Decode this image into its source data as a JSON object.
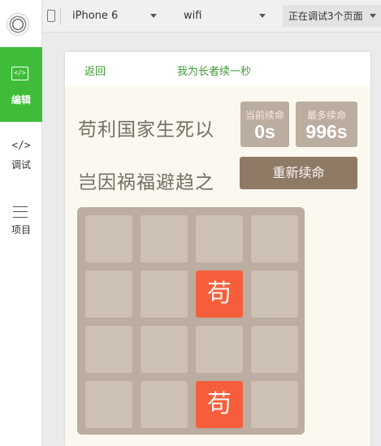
{
  "sidebar": {
    "items": [
      {
        "label": "编辑",
        "icon": "code-box-icon"
      },
      {
        "label": "调试",
        "icon": "code-icon"
      },
      {
        "label": "项目",
        "icon": "menu-icon"
      }
    ]
  },
  "toolbar": {
    "device": "iPhone 6",
    "network": "wifi",
    "debug_pages": "正在调试3个页面"
  },
  "page": {
    "back": "返回",
    "title": "我为长者续一秒",
    "lines": [
      "苟利国家生死以",
      "岂因祸福避趋之"
    ],
    "current_score_label": "当前续命",
    "current_score": "0s",
    "best_score_label": "最多续命",
    "best_score": "996s",
    "restart": "重新续命",
    "grid": [
      [
        "",
        "",
        "",
        ""
      ],
      [
        "",
        "",
        "苟",
        ""
      ],
      [
        "",
        "",
        "",
        ""
      ],
      [
        "",
        "",
        "苟",
        ""
      ]
    ]
  },
  "colors": {
    "accent_green": "#3fbd3a",
    "tile_empty": "#cdc1b4",
    "tile_filled": "#f65e3b",
    "board": "#bbada0",
    "button": "#8f7a66"
  }
}
